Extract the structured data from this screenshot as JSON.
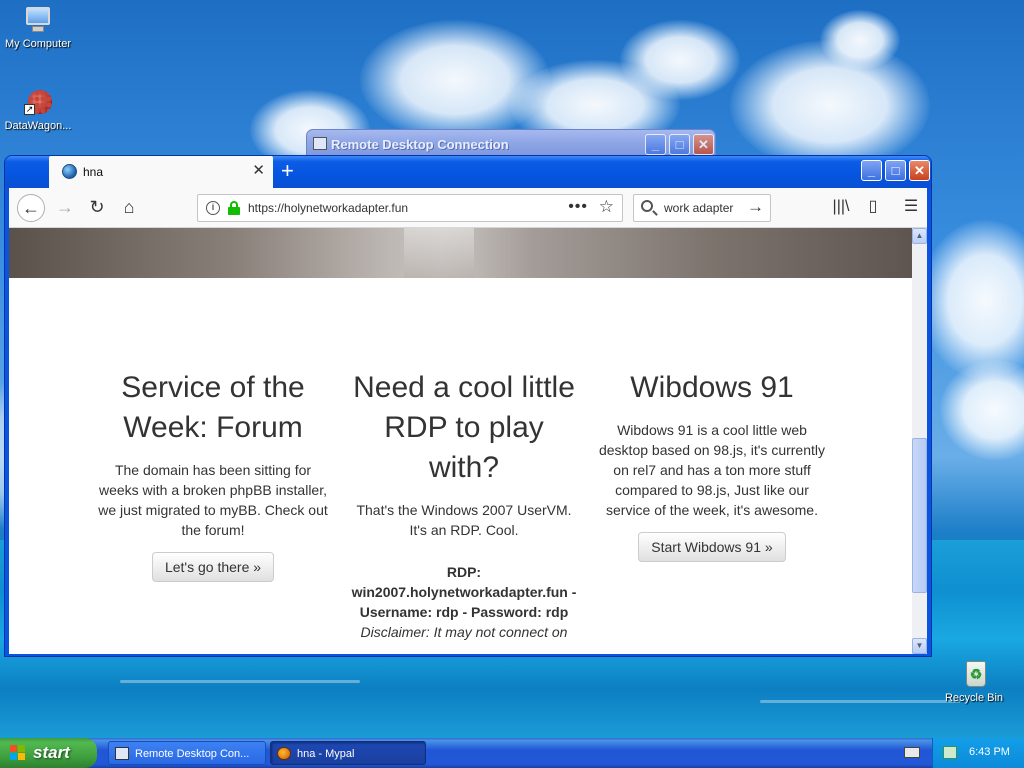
{
  "desktop": {
    "icons": [
      {
        "label": "My Computer"
      },
      {
        "label": "DataWagon..."
      },
      {
        "label": "Recycle Bin"
      }
    ]
  },
  "rdp_window": {
    "title": "Remote Desktop Connection",
    "buttons": {
      "minimize": "_",
      "maximize": "□",
      "close": "✕"
    }
  },
  "browser": {
    "window_buttons": {
      "minimize": "_",
      "maximize": "□",
      "close": "✕"
    },
    "tab": {
      "title": "hna",
      "close": "✕"
    },
    "new_tab": "+",
    "nav": {
      "back": "←",
      "forward": "→",
      "reload": "↻",
      "home": "⌂"
    },
    "url": "https://holynetworkadapter.fun",
    "url_info": "i",
    "page_actions": "•••",
    "bookmark": "☆",
    "search_query": "work adapter",
    "search_go": "→",
    "library": "|||\\",
    "sidebar": "▯",
    "menu": "☰"
  },
  "page": {
    "columns": [
      {
        "heading": "Service of the Week: Forum",
        "body": "The domain has been sitting for weeks with a broken phpBB installer, we just migrated to myBB. Check out the forum!",
        "button": "Let's go there »"
      },
      {
        "heading": "Need a cool little RDP to play with?",
        "body": "That's the Windows 2007 UserVM. It's an RDP. Cool.",
        "rdp_info": "RDP: win2007.holynetworkadapter.fun - Username: rdp - Password: rdp",
        "disclaimer": "Disclaimer: It may not connect on"
      },
      {
        "heading": "Wibdows 91",
        "body": "Wibdows 91 is a cool little web desktop based on 98.js, it's currently on rel7 and has a ton more stuff compared to 98.js, Just like our service of the week, it's awesome.",
        "button": "Start Wibdows 91 »"
      }
    ]
  },
  "scrollbar": {
    "up": "▲",
    "down": "▼"
  },
  "taskbar": {
    "start_label": "start",
    "tasks": [
      {
        "label": "Remote Desktop Con..."
      },
      {
        "label": "hna - Mypal"
      }
    ],
    "clock": "6:43 PM"
  },
  "colors": {
    "xp_blue": "#0a55e0",
    "start_green": "#3b9b3b",
    "lock_green": "#12bc00"
  }
}
